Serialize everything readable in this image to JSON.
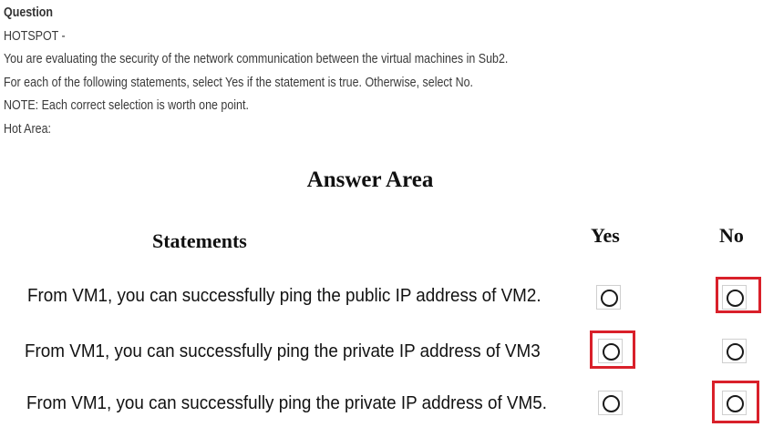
{
  "question": {
    "heading": "Question",
    "type": "HOTSPOT -",
    "lines": [
      "You are evaluating the security of the network communication between the virtual machines in Sub2.",
      "For each of the following statements, select Yes if the statement is true. Otherwise, select No.",
      "NOTE: Each correct selection is worth one point.",
      "Hot Area:"
    ]
  },
  "answer_area": {
    "title": "Answer Area",
    "statements_header": "Statements",
    "yes_header": "Yes",
    "no_header": "No",
    "rows": [
      {
        "text": "From VM1, you can successfully ping the public IP address of VM2.",
        "selected": "No"
      },
      {
        "text": "From VM1, you can successfully ping the private IP address of VM3",
        "selected": "Yes"
      },
      {
        "text": "From VM1, you can successfully ping the private IP address of VM5.",
        "selected": "No"
      }
    ],
    "selection_color": "#d9202a"
  }
}
